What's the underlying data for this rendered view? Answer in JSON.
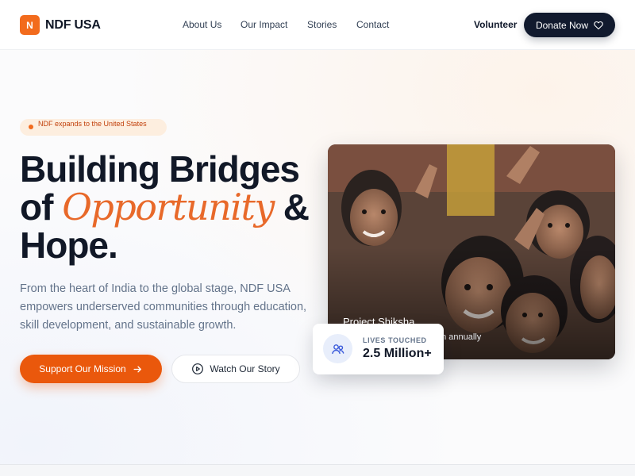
{
  "brand": {
    "logo_letter": "N",
    "name": "NDF USA",
    "accent": "#f26b1d",
    "dark": "#111a2e"
  },
  "nav": {
    "links": [
      "About Us",
      "Our Impact",
      "Stories",
      "Contact"
    ],
    "volunteer": "Volunteer",
    "donate": "Donate Now",
    "donate_icon": "heart-icon"
  },
  "hero": {
    "badge": "NDF expands to the United States",
    "headline_part1": "Building Bridges of ",
    "headline_accent": "Opportunity",
    "headline_part2": " & Hope.",
    "subtext": "From the heart of India to the global stage, NDF USA empowers underserved communities through education, skill development, and sustainable growth.",
    "primary_cta": "Support Our Mission",
    "primary_cta_icon": "arrow-right-icon",
    "secondary_cta": "Watch Our Story",
    "secondary_cta_icon": "play-circle-icon"
  },
  "feature": {
    "caption": "Project Shiksha",
    "caption_sub": "en annually",
    "stat_label": "LIVES TOUCHED",
    "stat_value": "2.5 Million+",
    "stat_icon": "users-icon"
  }
}
